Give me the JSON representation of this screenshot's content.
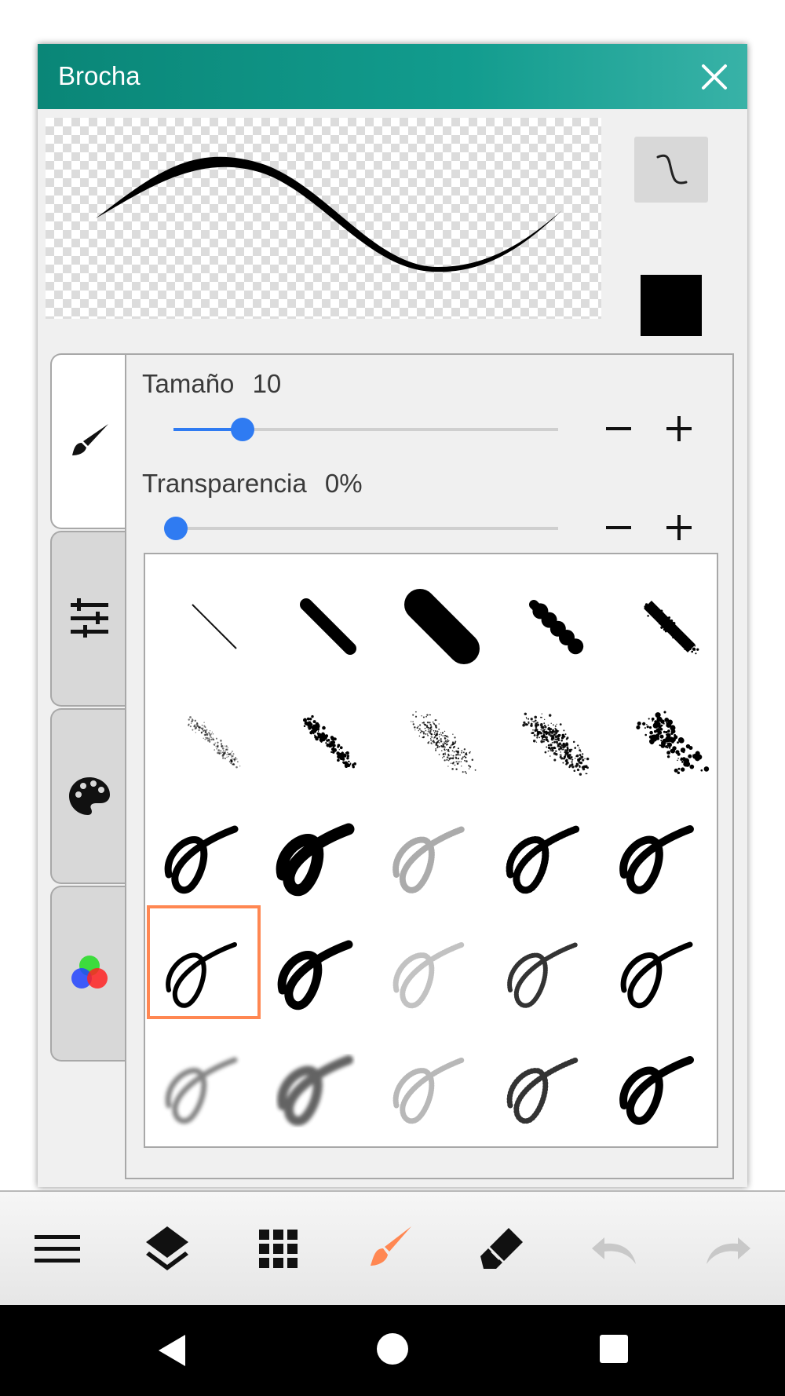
{
  "dialog": {
    "title": "Brocha",
    "brush_color": "#000000"
  },
  "controls": {
    "size_label": "Tamaño",
    "size_value": "10",
    "size_fraction": 0.18,
    "transparency_label": "Transparencia",
    "transparency_value": "0%",
    "transparency_fraction": 0.0,
    "minus": "−",
    "plus": "+"
  },
  "tabs": [
    "brush-tab",
    "adjustments-tab",
    "palette-tab",
    "color-mixer-tab"
  ],
  "brush_grid": {
    "rows": 5,
    "columns": 5,
    "selected_row": 4,
    "selected_column": 1
  },
  "toolbar": {
    "active_tool": "brush-tool",
    "accent": "#ff8752",
    "items": [
      "menu-icon",
      "layers-icon",
      "grid-icon",
      "brush-icon",
      "eraser-icon",
      "undo-icon",
      "redo-icon"
    ]
  },
  "colors": {
    "title_bar": "#0a8677",
    "slider": "#2f7bf2",
    "selection": "#ff8752"
  }
}
